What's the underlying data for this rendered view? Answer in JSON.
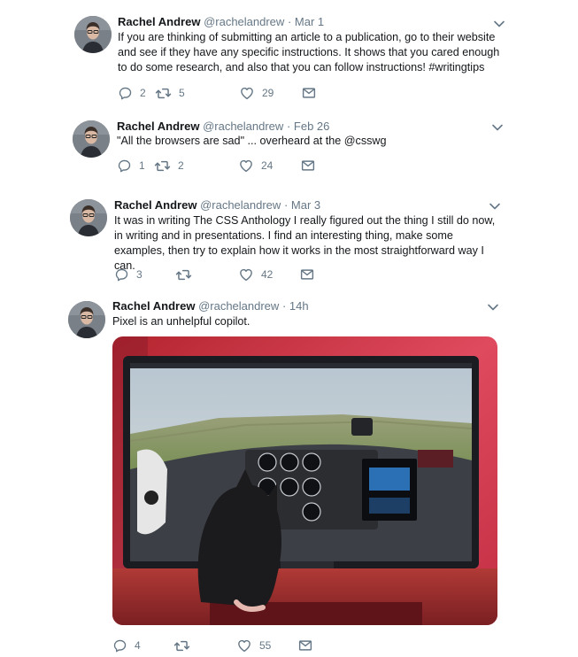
{
  "tweets": [
    {
      "name": "Rachel Andrew",
      "handle": "@rachelandrew",
      "separator": "·",
      "date": "Mar 1",
      "text": "If you are thinking of submitting an article to a publication, go to their website and see if they have any specific instructions. It shows that you cared enough to do some research, and also that you can follow instructions! #writingtips",
      "replies": "2",
      "retweets": "5",
      "likes": "29"
    },
    {
      "name": "Rachel Andrew",
      "handle": "@rachelandrew",
      "separator": "·",
      "date": "Feb 26",
      "text": "\"All the browsers are sad\" ... overheard at the @csswg",
      "replies": "1",
      "retweets": "2",
      "likes": "24"
    },
    {
      "name": "Rachel Andrew",
      "handle": "@rachelandrew",
      "separator": "·",
      "date": "Mar 3",
      "text": "It was in writing The CSS Anthology I really figured out the thing I still do now, in writing and in presentations. I find an interesting thing, make some examples, then try to explain how it works in the most straightforward way I can.",
      "replies": "3",
      "retweets": "",
      "likes": "42"
    },
    {
      "name": "Rachel Andrew",
      "handle": "@rachelandrew",
      "separator": "·",
      "date": "14h",
      "text": "Pixel is an unhelpful copilot.",
      "replies": "4",
      "retweets": "",
      "likes": "55",
      "media": "photo of a cat in front of a flight simulator screen"
    }
  ],
  "icons": {
    "reply": "reply-icon",
    "retweet": "retweet-icon",
    "like": "heart-icon",
    "dm": "mail-icon",
    "more": "chevron-down-icon"
  },
  "colors": {
    "text": "#14171a",
    "secondary": "#657786",
    "icon": "#657786"
  }
}
